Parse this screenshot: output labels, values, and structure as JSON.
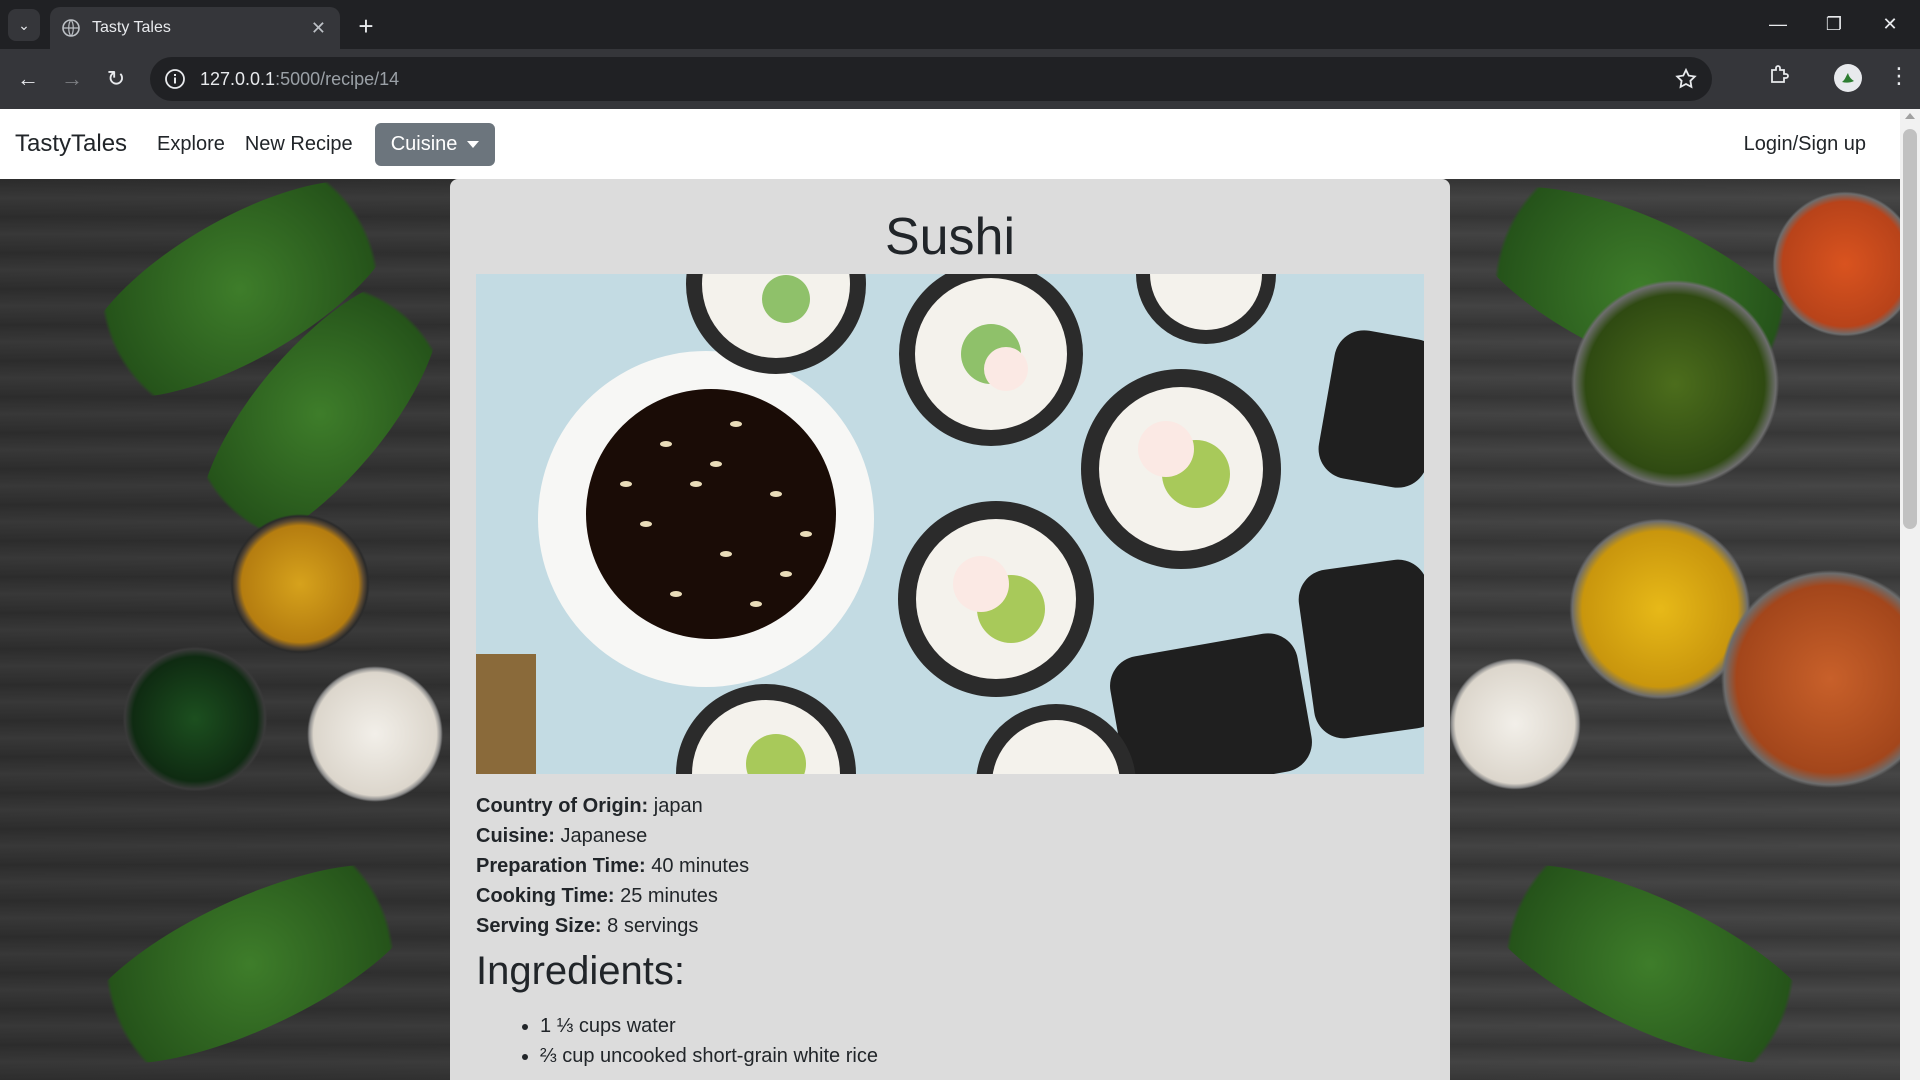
{
  "browser": {
    "tab_title": "Tasty Tales",
    "url_host": "127.0.0.1",
    "url_path": ":5000/recipe/14"
  },
  "navbar": {
    "brand": "TastyTales",
    "links": [
      "Explore",
      "New Recipe"
    ],
    "cuisine_label": "Cuisine",
    "login_label": "Login/Sign up"
  },
  "recipe": {
    "title": "Sushi",
    "details": [
      {
        "label": "Country of Origin:",
        "value": "japan"
      },
      {
        "label": "Cuisine:",
        "value": "Japanese"
      },
      {
        "label": "Preparation Time:",
        "value": "40 minutes"
      },
      {
        "label": "Cooking Time:",
        "value": "25 minutes"
      },
      {
        "label": "Serving Size:",
        "value": "8 servings"
      }
    ],
    "ingredients_heading": "Ingredients:",
    "ingredients": [
      "1 ⅓ cups water",
      "⅔ cup uncooked short-grain white rice"
    ]
  },
  "colors": {
    "card_bg": "#dcdcdc",
    "cuisine_button": "#6c757d",
    "chrome_dark": "#202124",
    "chrome_toolbar": "#35363a"
  },
  "icons": [
    "tab-search-icon",
    "globe-icon",
    "close-icon",
    "plus-icon",
    "minimize-icon",
    "restore-icon",
    "back-icon",
    "forward-icon",
    "reload-icon",
    "info-icon",
    "star-icon",
    "extensions-icon",
    "profile-icon",
    "menu-dots-icon",
    "caret-down-icon"
  ]
}
